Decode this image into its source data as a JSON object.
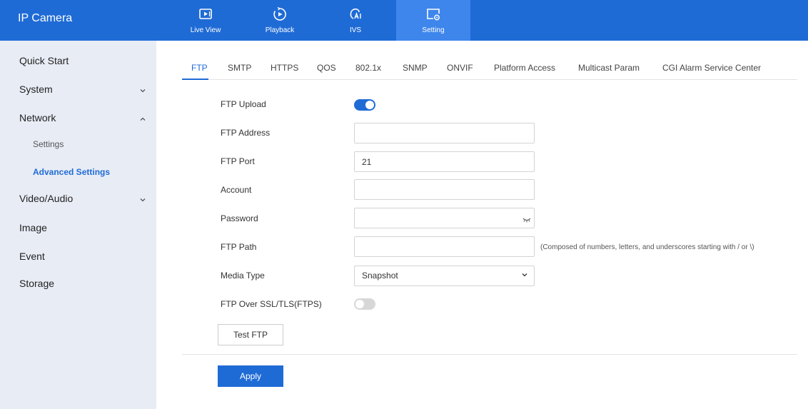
{
  "app": {
    "title": "IP Camera"
  },
  "topnav": {
    "items": [
      {
        "label": "Live View",
        "icon": "live-view-icon"
      },
      {
        "label": "Playback",
        "icon": "playback-icon"
      },
      {
        "label": "IVS",
        "icon": "ivs-icon"
      },
      {
        "label": "Setting",
        "icon": "setting-icon",
        "active": true
      }
    ]
  },
  "sidebar": {
    "items": [
      {
        "label": "Quick Start"
      },
      {
        "label": "System",
        "chevron": "chevron-down-icon"
      },
      {
        "label": "Network",
        "chevron": "chevron-up-icon",
        "expanded": true
      },
      {
        "label": "Video/Audio",
        "chevron": "chevron-down-icon"
      },
      {
        "label": "Image"
      },
      {
        "label": "Event"
      },
      {
        "label": "Storage"
      }
    ],
    "network_sub": [
      {
        "label": "Settings"
      },
      {
        "label": "Advanced Settings",
        "active": true
      }
    ]
  },
  "tabs": [
    "FTP",
    "SMTP",
    "HTTPS",
    "QOS",
    "802.1x",
    "SNMP",
    "ONVIF",
    "Platform Access",
    "Multicast Param",
    "CGI Alarm Service Center"
  ],
  "active_tab": "FTP",
  "form": {
    "ftp_upload": {
      "label": "FTP Upload",
      "on": true
    },
    "ftp_address": {
      "label": "FTP Address",
      "value": ""
    },
    "ftp_port": {
      "label": "FTP Port",
      "value": "21"
    },
    "account": {
      "label": "Account",
      "value": ""
    },
    "password": {
      "label": "Password",
      "value": "",
      "icon": "eye-closed-icon"
    },
    "ftp_path": {
      "label": "FTP Path",
      "value": "",
      "hint": "(Composed of numbers, letters, and underscores starting with / or \\)"
    },
    "media_type": {
      "label": "Media Type",
      "value": "Snapshot"
    },
    "ftps": {
      "label": "FTP Over SSL/TLS(FTPS)",
      "on": false
    }
  },
  "buttons": {
    "test_ftp": "Test FTP",
    "apply": "Apply"
  },
  "colors": {
    "accent": "#1f6bd6",
    "active_nav": "#3e86ec",
    "sidebar_bg": "#e8ecf5"
  }
}
